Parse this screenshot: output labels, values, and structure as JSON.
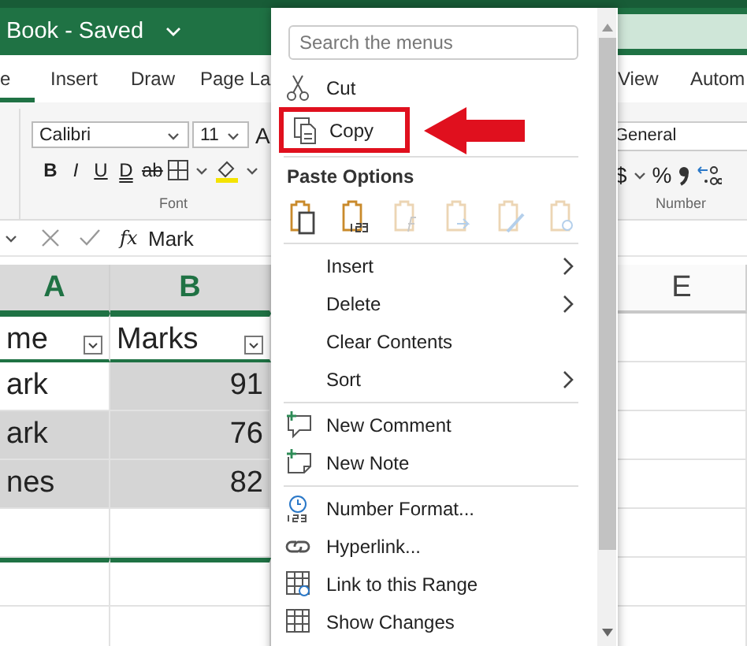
{
  "title_bar": {
    "title": "Book - Saved"
  },
  "ribbon_tabs": [
    {
      "label": "e",
      "selected": true
    },
    {
      "label": "Insert",
      "selected": false
    },
    {
      "label": "Draw",
      "selected": false
    },
    {
      "label": "Page La",
      "selected": false
    },
    {
      "label": "View",
      "selected": false
    },
    {
      "label": "Autom",
      "selected": false
    }
  ],
  "font_group": {
    "font_name": "Calibri",
    "font_size": "11",
    "grow_button": "A",
    "label": "Font",
    "format_buttons": [
      {
        "label": "B",
        "kind": "bold"
      },
      {
        "label": "I",
        "kind": "italic"
      },
      {
        "label": "U",
        "kind": "underline"
      },
      {
        "label": "D",
        "kind": "double-underline"
      },
      {
        "label": "ab",
        "kind": "strike"
      }
    ]
  },
  "number_group": {
    "format": "General",
    "currency": "$",
    "percent": "%",
    "label": "Number"
  },
  "formula_bar": {
    "function_label": "fx",
    "value": "Mark"
  },
  "columns": [
    {
      "label": "A",
      "selected": true
    },
    {
      "label": "B",
      "selected": true
    },
    {
      "label": "E",
      "selected": false
    }
  ],
  "rows": [
    {
      "kind": "header",
      "cells": [
        {
          "text": "me",
          "selected": false
        },
        {
          "text": "Marks",
          "selected": false
        }
      ]
    },
    {
      "kind": "data",
      "cells": [
        {
          "text": "ark",
          "selected": false
        },
        {
          "text": "91",
          "selected": true
        }
      ]
    },
    {
      "kind": "data",
      "cells": [
        {
          "text": "ark",
          "selected": true
        },
        {
          "text": "76",
          "selected": true
        }
      ]
    },
    {
      "kind": "data",
      "cells": [
        {
          "text": "nes",
          "selected": true
        },
        {
          "text": "82",
          "selected": true
        }
      ]
    }
  ],
  "context_menu": {
    "search": {
      "placeholder": "Search the menus"
    },
    "sections": [
      {
        "kind": "commands",
        "items": [
          {
            "label": "Cut",
            "submenu": false,
            "callout": false
          },
          {
            "label": "Copy",
            "submenu": false,
            "callout": true
          }
        ]
      },
      {
        "kind": "paste",
        "title": "Paste Options",
        "buttons": [
          {
            "disabled": false
          },
          {
            "disabled": false
          },
          {
            "disabled": true
          },
          {
            "disabled": true
          },
          {
            "disabled": true
          },
          {
            "disabled": true
          }
        ]
      },
      {
        "kind": "commands",
        "items": [
          {
            "label": "Insert",
            "submenu": true,
            "callout": false
          },
          {
            "label": "Delete",
            "submenu": true,
            "callout": false
          },
          {
            "label": "Clear Contents",
            "submenu": false,
            "callout": false
          },
          {
            "label": "Sort",
            "submenu": true,
            "callout": false
          }
        ]
      },
      {
        "kind": "commands",
        "items": [
          {
            "label": "New Comment",
            "submenu": false,
            "callout": false
          },
          {
            "label": "New Note",
            "submenu": false,
            "callout": false
          }
        ]
      },
      {
        "kind": "commands",
        "items": [
          {
            "label": "Number Format...",
            "submenu": false,
            "callout": false
          },
          {
            "label": "Hyperlink...",
            "submenu": false,
            "callout": false
          },
          {
            "label": "Link to this Range",
            "submenu": false,
            "callout": false
          },
          {
            "label": "Show Changes",
            "submenu": false,
            "callout": false
          }
        ]
      }
    ]
  }
}
